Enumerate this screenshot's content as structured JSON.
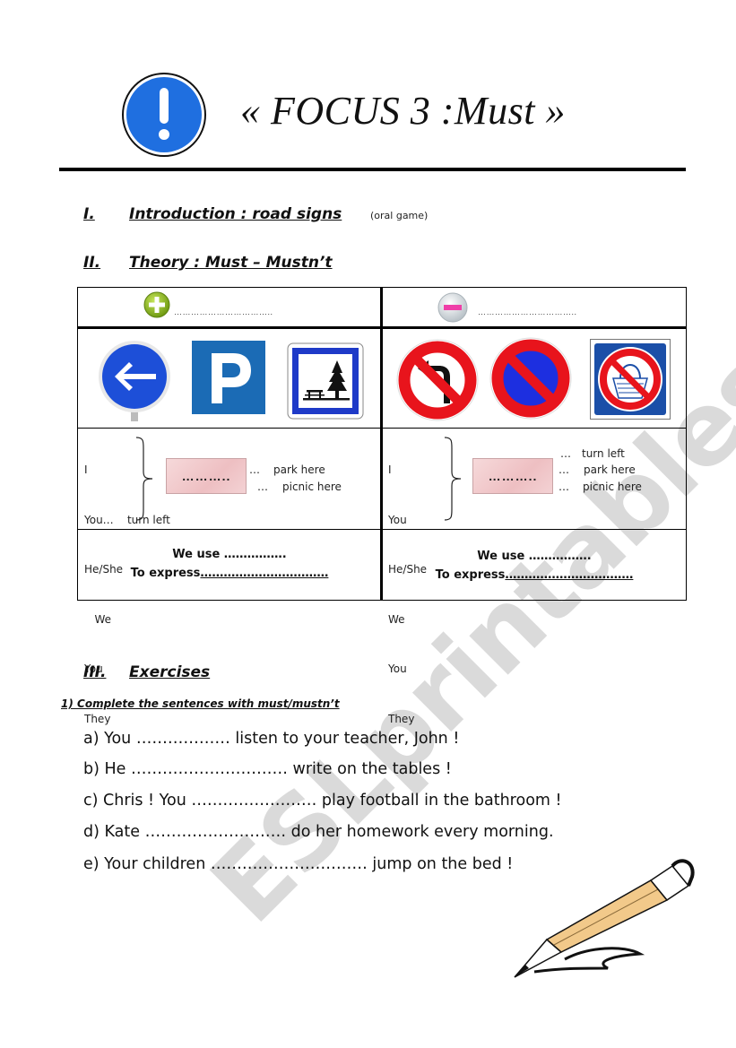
{
  "header": {
    "icon": "exclamation-sign-icon",
    "title": "« FOCUS 3 :Must »"
  },
  "sections": [
    {
      "number": "I.",
      "label": "Introduction : road signs",
      "note": "(oral game)"
    },
    {
      "number": "II.",
      "label": "Theory : Must – Mustn’t"
    },
    {
      "number": "III.",
      "label": "Exercises"
    }
  ],
  "theory_table": {
    "positive": {
      "icon": "plus-icon",
      "blank": "……………………………..",
      "signs": [
        "turn-left-mandatory-sign-icon",
        "parking-sign-icon",
        "picnic-area-sign-icon"
      ],
      "pronouns": [
        "I",
        "You…    turn left",
        "He/She",
        "   We",
        "You",
        "They"
      ],
      "box_text": "………..",
      "verbs": [
        {
          "dots": "…",
          "text": "park here"
        },
        {
          "dots": "…",
          "text": "picnic here"
        }
      ],
      "we_use": "We use …………….",
      "to_express_label": "To express",
      "to_express_blank": "……………………………"
    },
    "negative": {
      "icon": "minus-icon",
      "blank": "……………………………..",
      "signs": [
        "no-left-turn-sign-icon",
        "no-parking-sign-icon",
        "no-picnic-sign-icon"
      ],
      "pronouns": [
        "I",
        "You",
        "He/She",
        "We",
        "You",
        "They"
      ],
      "box_text": "………..",
      "verbs": [
        {
          "dots": "…",
          "text": "turn left"
        },
        {
          "dots": "…",
          "text": "park here"
        },
        {
          "dots": "…",
          "text": "picnic here"
        }
      ],
      "we_use": "We use  …………….",
      "to_express_label": "To express",
      "to_express_blank": "……………………………"
    }
  },
  "exercise": {
    "instruction": "1) Complete the sentences with must/mustn’t",
    "sentences": [
      "a) You ……………… listen to your teacher, John !",
      "b) He ………………………… write on the tables !",
      "c) Chris ! You …………………… play football in the bathroom !",
      "d) Kate ……………………… do her homework every morning.",
      "e) Your children ………………………… jump on the bed !"
    ]
  },
  "decoration": {
    "pencil": "pencil-icon",
    "watermark": "ESLprintables.com"
  }
}
